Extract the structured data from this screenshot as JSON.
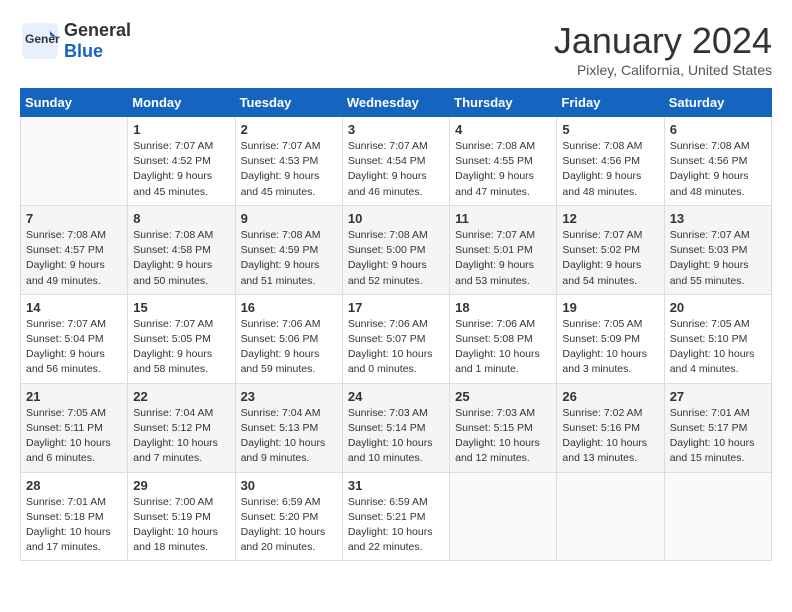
{
  "header": {
    "logo_line1": "General",
    "logo_line2": "Blue",
    "month": "January 2024",
    "location": "Pixley, California, United States"
  },
  "weekdays": [
    "Sunday",
    "Monday",
    "Tuesday",
    "Wednesday",
    "Thursday",
    "Friday",
    "Saturday"
  ],
  "weeks": [
    [
      {
        "day": "",
        "empty": true
      },
      {
        "day": "1",
        "sunrise": "7:07 AM",
        "sunset": "4:52 PM",
        "daylight": "9 hours and 45 minutes."
      },
      {
        "day": "2",
        "sunrise": "7:07 AM",
        "sunset": "4:53 PM",
        "daylight": "9 hours and 45 minutes."
      },
      {
        "day": "3",
        "sunrise": "7:07 AM",
        "sunset": "4:54 PM",
        "daylight": "9 hours and 46 minutes."
      },
      {
        "day": "4",
        "sunrise": "7:08 AM",
        "sunset": "4:55 PM",
        "daylight": "9 hours and 47 minutes."
      },
      {
        "day": "5",
        "sunrise": "7:08 AM",
        "sunset": "4:56 PM",
        "daylight": "9 hours and 48 minutes."
      },
      {
        "day": "6",
        "sunrise": "7:08 AM",
        "sunset": "4:56 PM",
        "daylight": "9 hours and 48 minutes."
      }
    ],
    [
      {
        "day": "7",
        "sunrise": "7:08 AM",
        "sunset": "4:57 PM",
        "daylight": "9 hours and 49 minutes."
      },
      {
        "day": "8",
        "sunrise": "7:08 AM",
        "sunset": "4:58 PM",
        "daylight": "9 hours and 50 minutes."
      },
      {
        "day": "9",
        "sunrise": "7:08 AM",
        "sunset": "4:59 PM",
        "daylight": "9 hours and 51 minutes."
      },
      {
        "day": "10",
        "sunrise": "7:08 AM",
        "sunset": "5:00 PM",
        "daylight": "9 hours and 52 minutes."
      },
      {
        "day": "11",
        "sunrise": "7:07 AM",
        "sunset": "5:01 PM",
        "daylight": "9 hours and 53 minutes."
      },
      {
        "day": "12",
        "sunrise": "7:07 AM",
        "sunset": "5:02 PM",
        "daylight": "9 hours and 54 minutes."
      },
      {
        "day": "13",
        "sunrise": "7:07 AM",
        "sunset": "5:03 PM",
        "daylight": "9 hours and 55 minutes."
      }
    ],
    [
      {
        "day": "14",
        "sunrise": "7:07 AM",
        "sunset": "5:04 PM",
        "daylight": "9 hours and 56 minutes."
      },
      {
        "day": "15",
        "sunrise": "7:07 AM",
        "sunset": "5:05 PM",
        "daylight": "9 hours and 58 minutes."
      },
      {
        "day": "16",
        "sunrise": "7:06 AM",
        "sunset": "5:06 PM",
        "daylight": "9 hours and 59 minutes."
      },
      {
        "day": "17",
        "sunrise": "7:06 AM",
        "sunset": "5:07 PM",
        "daylight": "10 hours and 0 minutes."
      },
      {
        "day": "18",
        "sunrise": "7:06 AM",
        "sunset": "5:08 PM",
        "daylight": "10 hours and 1 minute."
      },
      {
        "day": "19",
        "sunrise": "7:05 AM",
        "sunset": "5:09 PM",
        "daylight": "10 hours and 3 minutes."
      },
      {
        "day": "20",
        "sunrise": "7:05 AM",
        "sunset": "5:10 PM",
        "daylight": "10 hours and 4 minutes."
      }
    ],
    [
      {
        "day": "21",
        "sunrise": "7:05 AM",
        "sunset": "5:11 PM",
        "daylight": "10 hours and 6 minutes."
      },
      {
        "day": "22",
        "sunrise": "7:04 AM",
        "sunset": "5:12 PM",
        "daylight": "10 hours and 7 minutes."
      },
      {
        "day": "23",
        "sunrise": "7:04 AM",
        "sunset": "5:13 PM",
        "daylight": "10 hours and 9 minutes."
      },
      {
        "day": "24",
        "sunrise": "7:03 AM",
        "sunset": "5:14 PM",
        "daylight": "10 hours and 10 minutes."
      },
      {
        "day": "25",
        "sunrise": "7:03 AM",
        "sunset": "5:15 PM",
        "daylight": "10 hours and 12 minutes."
      },
      {
        "day": "26",
        "sunrise": "7:02 AM",
        "sunset": "5:16 PM",
        "daylight": "10 hours and 13 minutes."
      },
      {
        "day": "27",
        "sunrise": "7:01 AM",
        "sunset": "5:17 PM",
        "daylight": "10 hours and 15 minutes."
      }
    ],
    [
      {
        "day": "28",
        "sunrise": "7:01 AM",
        "sunset": "5:18 PM",
        "daylight": "10 hours and 17 minutes."
      },
      {
        "day": "29",
        "sunrise": "7:00 AM",
        "sunset": "5:19 PM",
        "daylight": "10 hours and 18 minutes."
      },
      {
        "day": "30",
        "sunrise": "6:59 AM",
        "sunset": "5:20 PM",
        "daylight": "10 hours and 20 minutes."
      },
      {
        "day": "31",
        "sunrise": "6:59 AM",
        "sunset": "5:21 PM",
        "daylight": "10 hours and 22 minutes."
      },
      {
        "day": "",
        "empty": true
      },
      {
        "day": "",
        "empty": true
      },
      {
        "day": "",
        "empty": true
      }
    ]
  ]
}
